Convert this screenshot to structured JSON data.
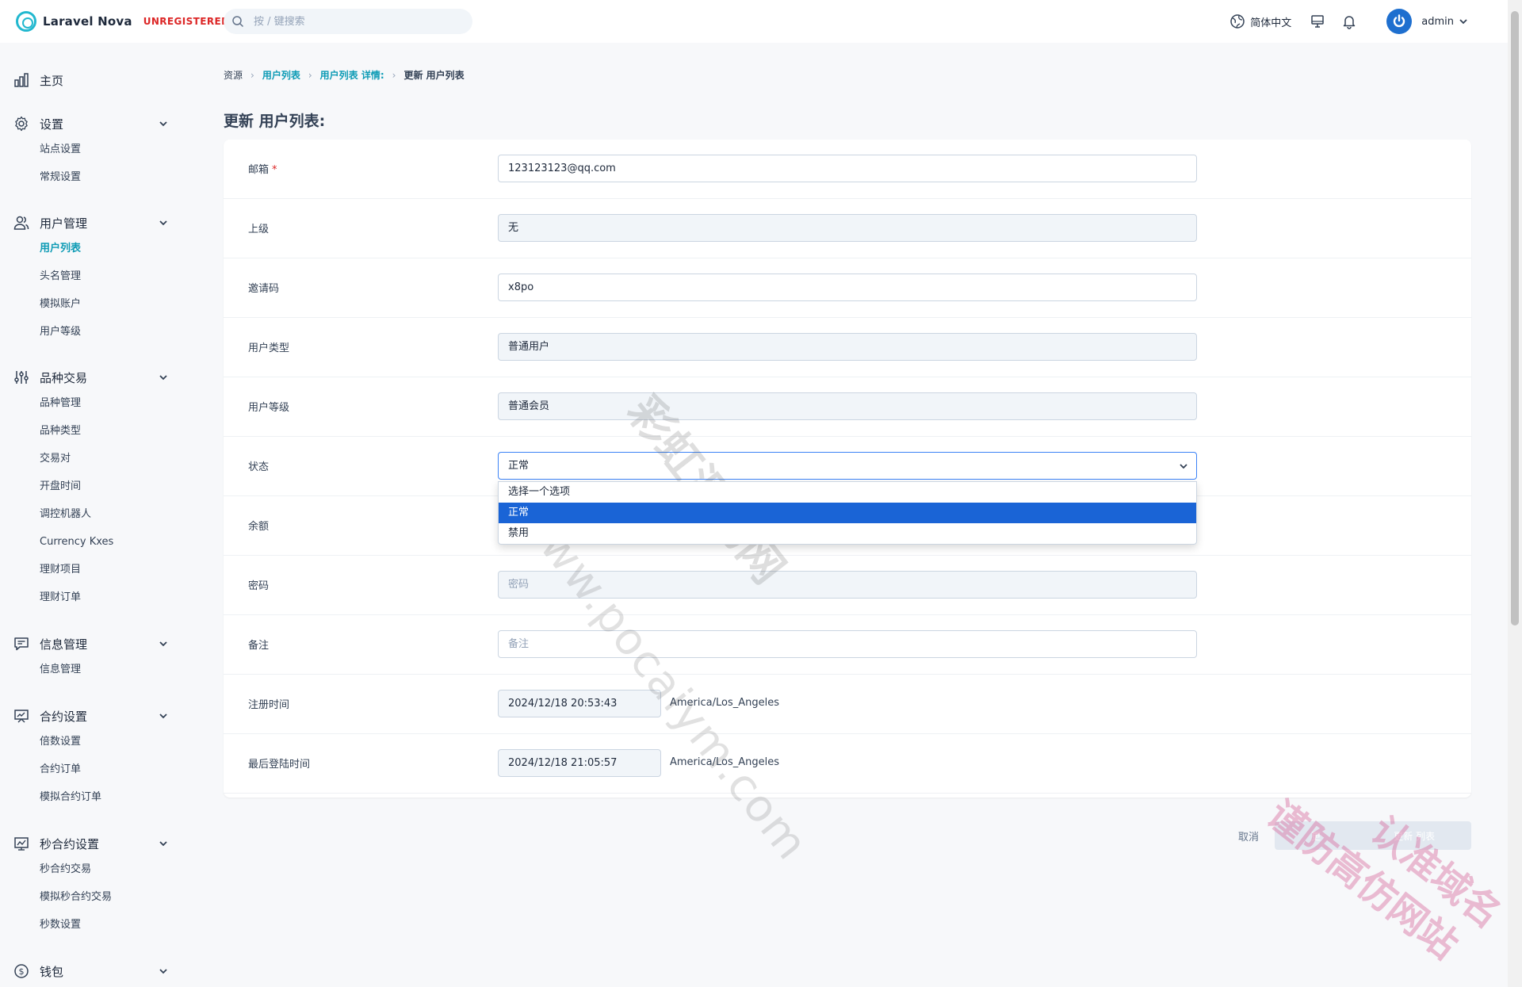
{
  "app": {
    "name": "Laravel Nova",
    "badge": "UNREGISTERED"
  },
  "search": {
    "placeholder": "按 / 键搜索"
  },
  "header": {
    "language": "简体中文",
    "user": "admin"
  },
  "sidebar": {
    "home": "主页",
    "groups": [
      {
        "label": "设置",
        "icon": "gear-icon",
        "items": [
          "站点设置",
          "常规设置"
        ]
      },
      {
        "label": "用户管理",
        "icon": "users-icon",
        "items": [
          "用户列表",
          "头名管理",
          "模拟账户",
          "用户等级"
        ],
        "active": "用户列表"
      },
      {
        "label": "品种交易",
        "icon": "sliders-icon",
        "items": [
          "品种管理",
          "品种类型",
          "交易对",
          "开盘时间",
          "调控机器人",
          "Currency Kxes",
          "理财项目",
          "理财订单"
        ]
      },
      {
        "label": "信息管理",
        "icon": "chat-icon",
        "items": [
          "信息管理"
        ]
      },
      {
        "label": "合约设置",
        "icon": "presentation-chart-icon",
        "items": [
          "倍数设置",
          "合约订单",
          "模拟合约订单"
        ]
      },
      {
        "label": "秒合约设置",
        "icon": "trend-chart-icon",
        "items": [
          "秒合约交易",
          "模拟秒合约交易",
          "秒数设置"
        ]
      },
      {
        "label": "钱包",
        "icon": "dollar-icon",
        "items": []
      }
    ]
  },
  "breadcrumb": [
    "资源",
    "用户列表",
    "用户列表 详情:",
    "更新 用户列表"
  ],
  "page_title": "更新 用户列表:",
  "form": {
    "email": {
      "label": "邮箱",
      "required": "*",
      "value": "123123123@qq.com"
    },
    "parent": {
      "label": "上级",
      "value": "无"
    },
    "invite": {
      "label": "邀请码",
      "value": "x8po"
    },
    "user_type": {
      "label": "用户类型",
      "value": "普通用户"
    },
    "user_level": {
      "label": "用户等级",
      "value": "普通会员"
    },
    "status": {
      "label": "状态",
      "value": "正常",
      "options": [
        "选择一个选项",
        "正常",
        "禁用"
      ]
    },
    "balance": {
      "label": "余额"
    },
    "password": {
      "label": "密码",
      "placeholder": "密码"
    },
    "remark": {
      "label": "备注",
      "placeholder": "备注"
    },
    "registered": {
      "label": "注册时间",
      "value": "2024/12/18 20:53:43",
      "tz": "America/Los_Angeles"
    },
    "last_login": {
      "label": "最后登陆时间",
      "value": "2024/12/18 21:05:57",
      "tz": "America/Los_Angeles"
    }
  },
  "actions": {
    "cancel": "取消",
    "primary_a": "更",
    "primary_b": "更新 列表"
  },
  "watermarks": {
    "url": "www.pocaiym.com",
    "cn1": "彩虹源码网",
    "cn2": "谨防高仿网站",
    "cn3": "认准域名"
  },
  "colors": {
    "accent": "#0e9bb5",
    "select_highlight": "#1a64d6",
    "required": "#dc2626"
  }
}
